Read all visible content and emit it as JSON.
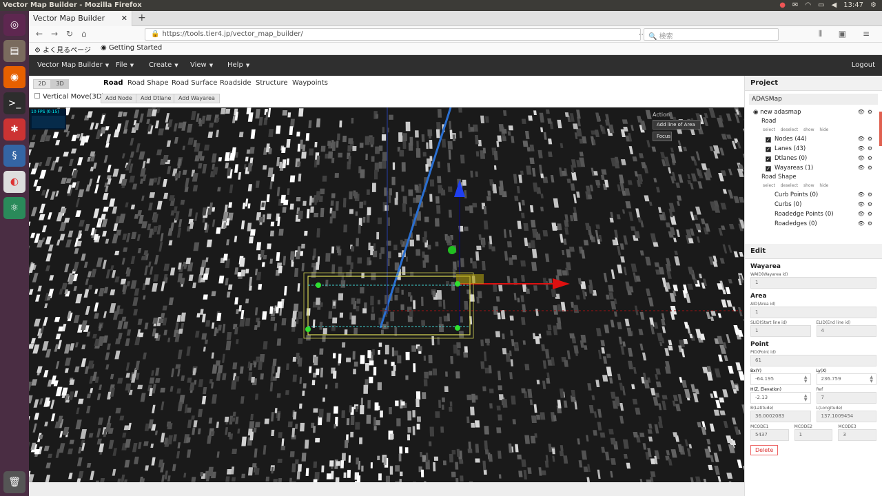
{
  "os": {
    "window_title": "Vector Map Builder - Mozilla Firefox",
    "time": "13:47"
  },
  "browser": {
    "tab_title": "Vector Map Builder",
    "url": "https://tools.tier4.jp/vector_map_builder/",
    "search_placeholder": "検索",
    "bookmarks": [
      "よく見るページ",
      "Getting Started"
    ]
  },
  "app": {
    "menus": [
      "Vector Map Builder",
      "File",
      "Create",
      "View",
      "Help"
    ],
    "logout": "Logout",
    "view_toggle": [
      "2D",
      "3D"
    ],
    "tabs": [
      "Road",
      "Road Shape",
      "Road Surface",
      "Roadside",
      "Structure",
      "Waypoints"
    ],
    "vertical_move": "Vertical Move(3D)",
    "actions": [
      "Add Node",
      "Add Dtlane",
      "Add Wayarea"
    ],
    "fps_label": "10 FPS (0-15)",
    "viewport_action": {
      "label": "Action",
      "buttons": [
        "Add line of Area",
        "Focus"
      ]
    }
  },
  "project": {
    "header": "Project",
    "map_name": "ADASMap",
    "root": "new adasmap",
    "groups": [
      {
        "name": "Road",
        "controls": "select deselect show hide",
        "layers": [
          {
            "label": "Nodes (44)",
            "checked": true
          },
          {
            "label": "Lanes (43)",
            "checked": true
          },
          {
            "label": "Dtlanes (0)",
            "checked": true
          },
          {
            "label": "Wayareas (1)",
            "checked": true
          }
        ]
      },
      {
        "name": "Road Shape",
        "controls": "select deselect show hide",
        "layers": [
          {
            "label": "Curb Points (0)",
            "checked": false
          },
          {
            "label": "Curbs (0)",
            "checked": false
          },
          {
            "label": "Roadedge Points (0)",
            "checked": false
          },
          {
            "label": "Roadedges (0)",
            "checked": false
          }
        ]
      }
    ]
  },
  "edit": {
    "header": "Edit",
    "wayarea": {
      "title": "Wayarea",
      "waid_label": "WAID(Wayarea id)",
      "waid": "1"
    },
    "area": {
      "title": "Area",
      "aid_label": "AID(Area id)",
      "aid": "1",
      "slid_label": "SLID(Start line id)",
      "slid": "1",
      "elid_label": "ELID(End line id)",
      "elid": "4"
    },
    "point": {
      "title": "Point",
      "pid_label": "PID(Point id)",
      "pid": "61",
      "bx_label": "Bx(Y)",
      "bx": "-64.195",
      "ly_label": "Ly(X)",
      "ly": "236.759",
      "h_label": "H(Z, Elevation)",
      "h": "-2.13",
      "ref_label": "Ref",
      "ref": "7",
      "b_label": "B(Latitude)",
      "b": "36.0002083",
      "l_label": "L(Longitude)",
      "l": "137.1009454",
      "mcode1_label": "MCODE1",
      "mcode1": "5437",
      "mcode2_label": "MCODE2",
      "mcode2": "1",
      "mcode3_label": "MCODE3",
      "mcode3": "3"
    },
    "delete": "Delete"
  }
}
